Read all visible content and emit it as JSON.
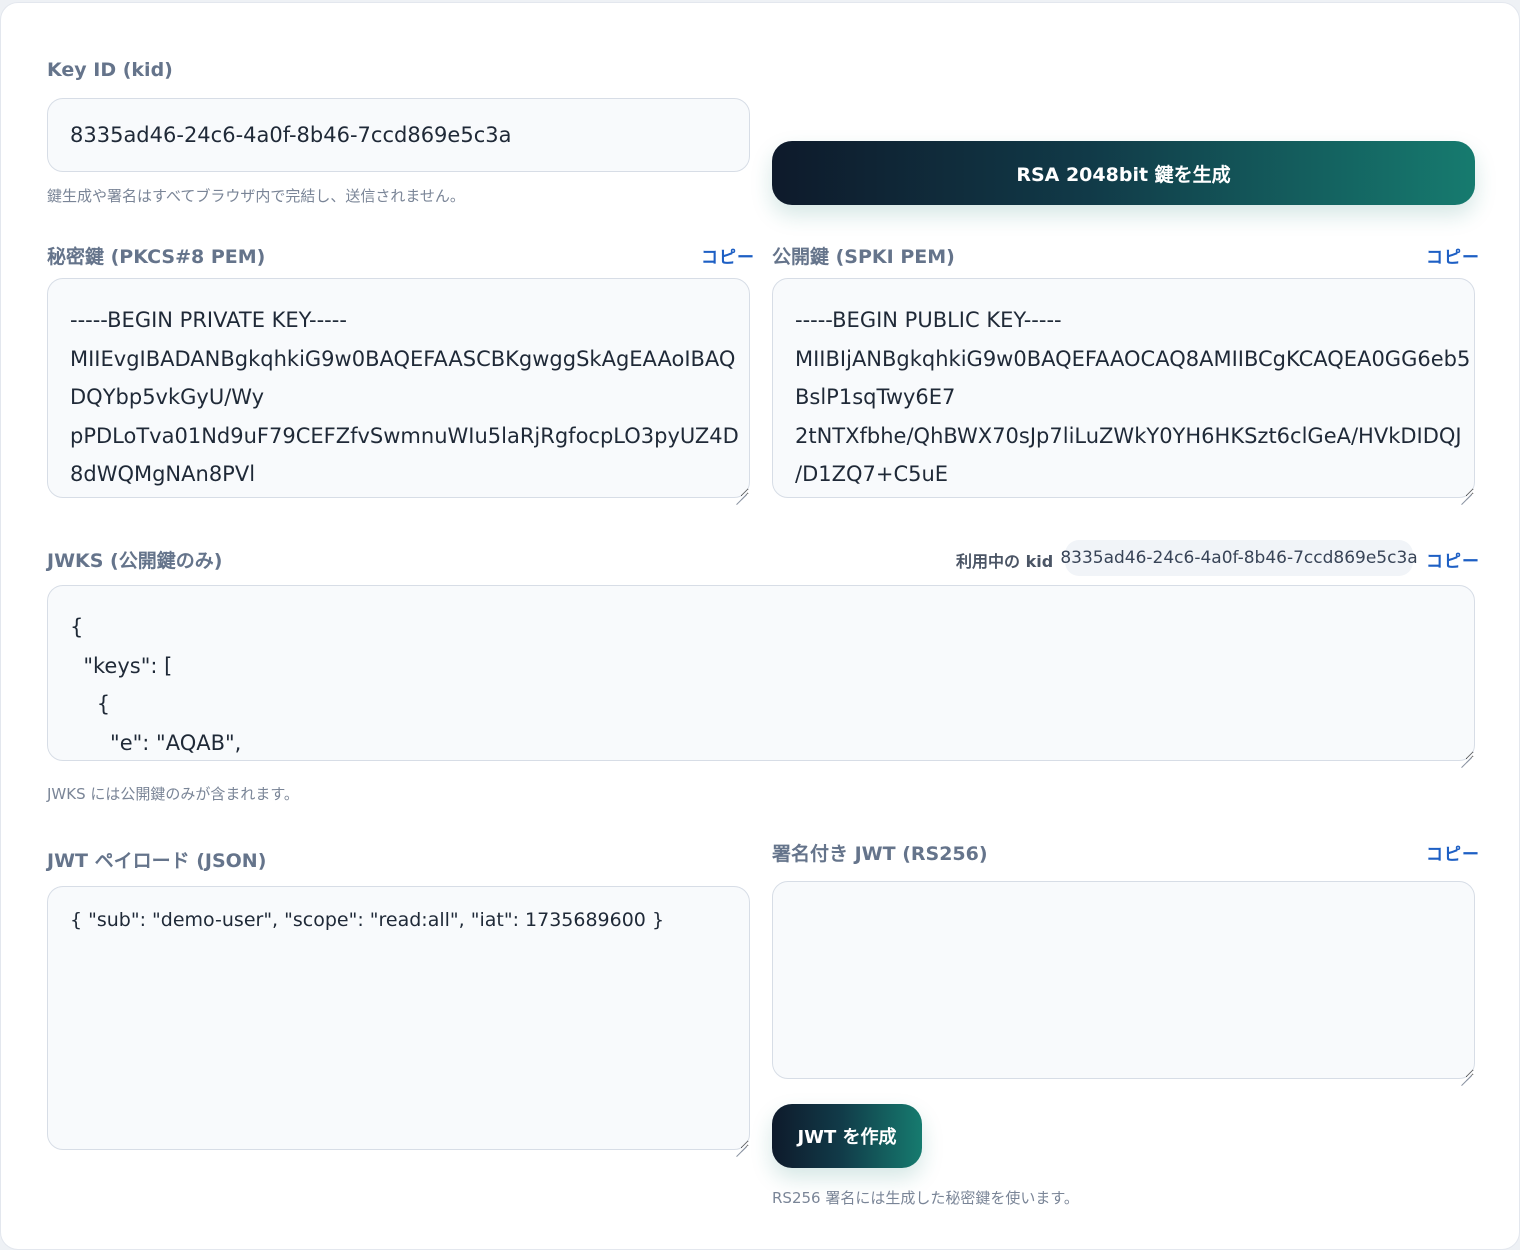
{
  "key_id": {
    "label": "Key ID (kid)",
    "value": "8335ad46-24c6-4a0f-8b46-7ccd869e5c3a",
    "help": "鍵生成や署名はすべてブラウザ内で完結し、送信されません。"
  },
  "generate_button": {
    "label": "RSA 2048bit 鍵を生成"
  },
  "private_key": {
    "label": "秘密鍵 (PKCS#8 PEM)",
    "copy_label": "コピー",
    "value": "-----BEGIN PRIVATE KEY-----\nMIIEvgIBADANBgkqhkiG9w0BAQEFAASCBKgwggSkAgEAAoIBAQ\nDQYbp5vkGyU/Wy\npPDLoTva01Nd9uF79CEFZfvSwmnuWIu5laRjRgfocpLO3pyUZ4D\n8dWQMgNAn8PVl"
  },
  "public_key": {
    "label": "公開鍵 (SPKI PEM)",
    "copy_label": "コピー",
    "value": "-----BEGIN PUBLIC KEY-----\nMIIBIjANBgkqhkiG9w0BAQEFAAOCAQ8AMIIBCgKCAQEA0GG6eb5\nBslP1sqTwy6E7\n2tNTXfbhe/QhBWX70sJp7liLuZWkY0YH6HKSzt6clGeA/HVkDIDQJ\n/D1ZQ7+C5uE"
  },
  "jwks": {
    "label": "JWKS (公開鍵のみ)",
    "active_kid_label": "利用中の kid",
    "active_kid_value": "8335ad46-24c6-4a0f-8b46-7ccd869e5c3a",
    "copy_label": "コピー",
    "value": "{\n  \"keys\": [\n    {\n      \"e\": \"AQAB\",",
    "help": "JWKS には公開鍵のみが含まれます。"
  },
  "payload": {
    "label": "JWT ペイロード (JSON)",
    "value": "{ \"sub\": \"demo-user\", \"scope\": \"read:all\", \"iat\": 1735689600 }"
  },
  "signed_jwt": {
    "label": "署名付き JWT (RS256)",
    "copy_label": "コピー",
    "value": ""
  },
  "create_jwt_button": {
    "label": "JWT を作成"
  },
  "signing_help": "RS256 署名には生成した秘密鍵を使います。"
}
